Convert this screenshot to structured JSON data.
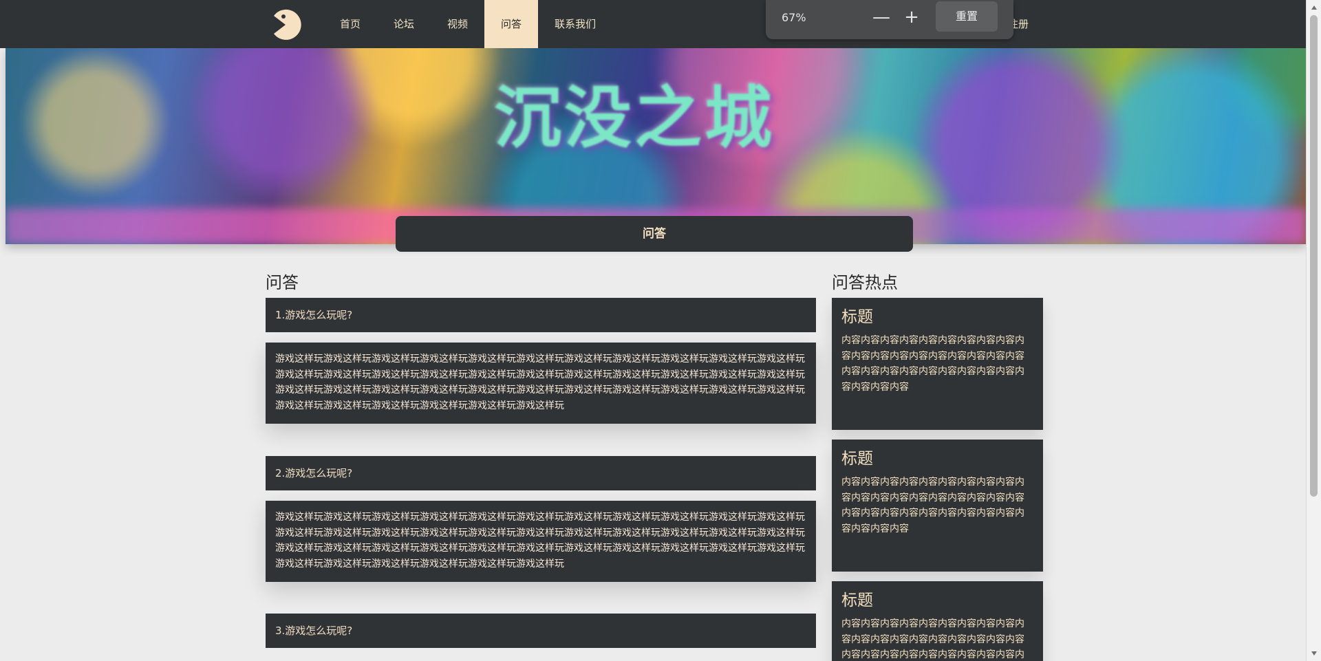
{
  "nav": {
    "items": [
      {
        "label": "首页"
      },
      {
        "label": "论坛"
      },
      {
        "label": "视频"
      },
      {
        "label": "问答",
        "active": true
      },
      {
        "label": "联系我们"
      }
    ],
    "register": "注册"
  },
  "zoom": {
    "level": "67%",
    "reset": "重置"
  },
  "banner": {
    "title": "沉没之城"
  },
  "qa": {
    "bar_label": "问答",
    "section_title": "问答",
    "items": [
      {
        "question": "1.游戏怎么玩呢?",
        "answer": "游戏这样玩游戏这样玩游戏这样玩游戏这样玩游戏这样玩游戏这样玩游戏这样玩游戏这样玩游戏这样玩游戏这样玩游戏这样玩游戏这样玩游戏这样玩游戏这样玩游戏这样玩游戏这样玩游戏这样玩游戏这样玩游戏这样玩游戏这样玩游戏这样玩游戏这样玩游戏这样玩游戏这样玩游戏这样玩游戏这样玩游戏这样玩游戏这样玩游戏这样玩游戏这样玩游戏这样玩游戏这样玩游戏这样玩游戏这样玩游戏这样玩游戏这样玩游戏这样玩游戏这样玩游戏这样玩"
      },
      {
        "question": "2.游戏怎么玩呢?",
        "answer": "游戏这样玩游戏这样玩游戏这样玩游戏这样玩游戏这样玩游戏这样玩游戏这样玩游戏这样玩游戏这样玩游戏这样玩游戏这样玩游戏这样玩游戏这样玩游戏这样玩游戏这样玩游戏这样玩游戏这样玩游戏这样玩游戏这样玩游戏这样玩游戏这样玩游戏这样玩游戏这样玩游戏这样玩游戏这样玩游戏这样玩游戏这样玩游戏这样玩游戏这样玩游戏这样玩游戏这样玩游戏这样玩游戏这样玩游戏这样玩游戏这样玩游戏这样玩游戏这样玩游戏这样玩游戏这样玩"
      },
      {
        "question": "3.游戏怎么玩呢?"
      }
    ]
  },
  "hot": {
    "section_title": "问答热点",
    "cards": [
      {
        "title": "标题",
        "content": "内容内容内容内容内容内容内容内容内容内容内容内容内容内容内容内容内容内容内容内容内容内容内容内容内容内容内容内容内容内容内容内容"
      },
      {
        "title": "标题",
        "content": "内容内容内容内容内容内容内容内容内容内容内容内容内容内容内容内容内容内容内容内容内容内容内容内容内容内容内容内容内容内容内容内容"
      },
      {
        "title": "标题",
        "content": "内容内容内容内容内容内容内容内容内容内容内容内容内容内容内容内容内容内容内容内容内容内容内容内容内容内容内容内容内容内容内容内容"
      }
    ]
  }
}
